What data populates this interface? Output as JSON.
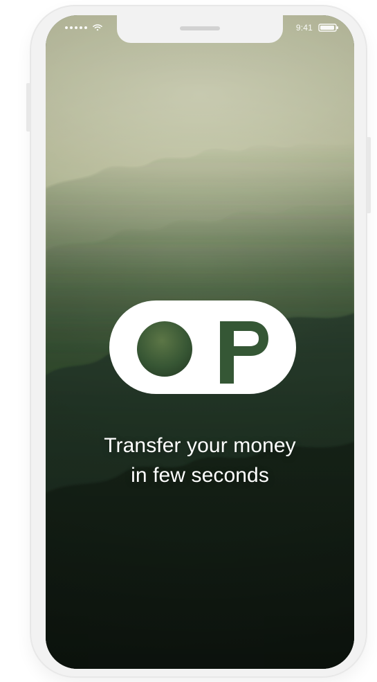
{
  "status_bar": {
    "time": "9:41"
  },
  "logo": {
    "letters": [
      "O",
      "P"
    ]
  },
  "tagline": {
    "line1": "Transfer your money",
    "line2": "in few seconds"
  },
  "colors": {
    "text": "#ffffff",
    "logo_bg": "#ffffff",
    "logo_fill": "#3a5a38"
  },
  "icons": {
    "signal": "signal-dots-icon",
    "wifi": "wifi-icon",
    "battery": "battery-icon"
  }
}
